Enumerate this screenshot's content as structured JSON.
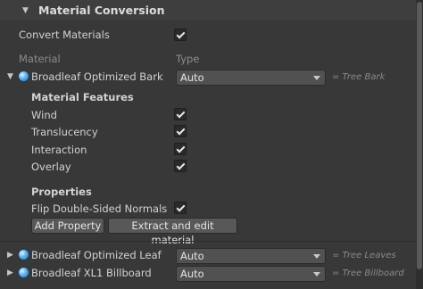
{
  "section": {
    "title": "Material Conversion"
  },
  "convert": {
    "label": "Convert Materials",
    "checked": true
  },
  "columns": {
    "material": "Material",
    "type": "Type"
  },
  "materials": [
    {
      "name": "Broadleaf Optimized Bark",
      "type": "Auto",
      "note": "= Tree Bark",
      "expanded": true,
      "features_title": "Material Features",
      "features": [
        {
          "label": "Wind",
          "checked": true
        },
        {
          "label": "Translucency",
          "checked": true
        },
        {
          "label": "Interaction",
          "checked": true
        },
        {
          "label": "Overlay",
          "checked": true
        }
      ],
      "properties_title": "Properties",
      "properties": [
        {
          "label": "Flip Double-Sided Normals",
          "checked": true
        }
      ],
      "add_property_label": "Add Property",
      "extract_label": "Extract and edit material"
    },
    {
      "name": "Broadleaf Optimized Leaf",
      "type": "Auto",
      "note": "= Tree Leaves",
      "expanded": false
    },
    {
      "name": "Broadleaf XL1 Billboard",
      "type": "Auto",
      "note": "= Tree Billboard",
      "expanded": false
    }
  ]
}
